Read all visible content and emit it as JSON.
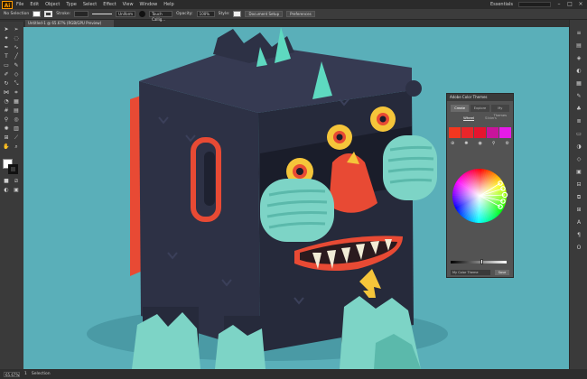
{
  "app": {
    "logo": "Ai"
  },
  "menu": {
    "items": [
      "File",
      "Edit",
      "Object",
      "Type",
      "Select",
      "Effect",
      "View",
      "Window",
      "Help"
    ],
    "workspace": "Essentials"
  },
  "control_bar": {
    "selection_label": "No Selection",
    "stroke_label": "Stroke:",
    "stroke_value": "",
    "stroke_style": "Uniform",
    "brush": "Touch Callig...",
    "opacity_label": "Opacity:",
    "opacity_value": "100%",
    "style_label": "Style:",
    "document_setup": "Document Setup",
    "preferences": "Preferences"
  },
  "document_tab": {
    "title": "Untitled-1 @ 65.67% (RGB/GPU Preview)"
  },
  "color_panel": {
    "title": "Adobe Color Themes",
    "tabs": [
      "Create",
      "Explore",
      "My Themes"
    ],
    "active_tab": "Create",
    "subtabs": [
      "Wheel",
      "Sliders"
    ],
    "active_subtab": "Wheel",
    "swatch_colors": [
      "#f2371f",
      "#e9262a",
      "#e6142e",
      "#c8149b",
      "#e61be8"
    ],
    "theme_name_placeholder": "My Color Theme",
    "save_label": "Save",
    "brightness": 0.56
  },
  "status_bar": {
    "zoom": "65.67%",
    "artboard": "1",
    "tool": "Selection"
  },
  "icons": {
    "window": [
      "minimize-icon",
      "maximize-icon",
      "close-icon"
    ],
    "panel_row": [
      "add-to-swatches-icon",
      "harmony-icon",
      "camera-icon",
      "eyedropper-icon",
      "settings-icon"
    ]
  }
}
